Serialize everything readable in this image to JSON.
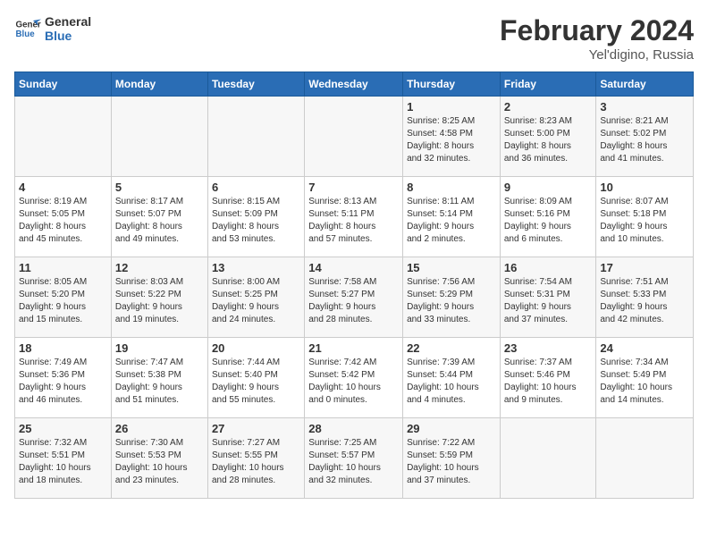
{
  "header": {
    "logo_line1": "General",
    "logo_line2": "Blue",
    "month_year": "February 2024",
    "location": "Yel'digino, Russia"
  },
  "weekdays": [
    "Sunday",
    "Monday",
    "Tuesday",
    "Wednesday",
    "Thursday",
    "Friday",
    "Saturday"
  ],
  "weeks": [
    [
      {
        "day": "",
        "info": ""
      },
      {
        "day": "",
        "info": ""
      },
      {
        "day": "",
        "info": ""
      },
      {
        "day": "",
        "info": ""
      },
      {
        "day": "1",
        "info": "Sunrise: 8:25 AM\nSunset: 4:58 PM\nDaylight: 8 hours\nand 32 minutes."
      },
      {
        "day": "2",
        "info": "Sunrise: 8:23 AM\nSunset: 5:00 PM\nDaylight: 8 hours\nand 36 minutes."
      },
      {
        "day": "3",
        "info": "Sunrise: 8:21 AM\nSunset: 5:02 PM\nDaylight: 8 hours\nand 41 minutes."
      }
    ],
    [
      {
        "day": "4",
        "info": "Sunrise: 8:19 AM\nSunset: 5:05 PM\nDaylight: 8 hours\nand 45 minutes."
      },
      {
        "day": "5",
        "info": "Sunrise: 8:17 AM\nSunset: 5:07 PM\nDaylight: 8 hours\nand 49 minutes."
      },
      {
        "day": "6",
        "info": "Sunrise: 8:15 AM\nSunset: 5:09 PM\nDaylight: 8 hours\nand 53 minutes."
      },
      {
        "day": "7",
        "info": "Sunrise: 8:13 AM\nSunset: 5:11 PM\nDaylight: 8 hours\nand 57 minutes."
      },
      {
        "day": "8",
        "info": "Sunrise: 8:11 AM\nSunset: 5:14 PM\nDaylight: 9 hours\nand 2 minutes."
      },
      {
        "day": "9",
        "info": "Sunrise: 8:09 AM\nSunset: 5:16 PM\nDaylight: 9 hours\nand 6 minutes."
      },
      {
        "day": "10",
        "info": "Sunrise: 8:07 AM\nSunset: 5:18 PM\nDaylight: 9 hours\nand 10 minutes."
      }
    ],
    [
      {
        "day": "11",
        "info": "Sunrise: 8:05 AM\nSunset: 5:20 PM\nDaylight: 9 hours\nand 15 minutes."
      },
      {
        "day": "12",
        "info": "Sunrise: 8:03 AM\nSunset: 5:22 PM\nDaylight: 9 hours\nand 19 minutes."
      },
      {
        "day": "13",
        "info": "Sunrise: 8:00 AM\nSunset: 5:25 PM\nDaylight: 9 hours\nand 24 minutes."
      },
      {
        "day": "14",
        "info": "Sunrise: 7:58 AM\nSunset: 5:27 PM\nDaylight: 9 hours\nand 28 minutes."
      },
      {
        "day": "15",
        "info": "Sunrise: 7:56 AM\nSunset: 5:29 PM\nDaylight: 9 hours\nand 33 minutes."
      },
      {
        "day": "16",
        "info": "Sunrise: 7:54 AM\nSunset: 5:31 PM\nDaylight: 9 hours\nand 37 minutes."
      },
      {
        "day": "17",
        "info": "Sunrise: 7:51 AM\nSunset: 5:33 PM\nDaylight: 9 hours\nand 42 minutes."
      }
    ],
    [
      {
        "day": "18",
        "info": "Sunrise: 7:49 AM\nSunset: 5:36 PM\nDaylight: 9 hours\nand 46 minutes."
      },
      {
        "day": "19",
        "info": "Sunrise: 7:47 AM\nSunset: 5:38 PM\nDaylight: 9 hours\nand 51 minutes."
      },
      {
        "day": "20",
        "info": "Sunrise: 7:44 AM\nSunset: 5:40 PM\nDaylight: 9 hours\nand 55 minutes."
      },
      {
        "day": "21",
        "info": "Sunrise: 7:42 AM\nSunset: 5:42 PM\nDaylight: 10 hours\nand 0 minutes."
      },
      {
        "day": "22",
        "info": "Sunrise: 7:39 AM\nSunset: 5:44 PM\nDaylight: 10 hours\nand 4 minutes."
      },
      {
        "day": "23",
        "info": "Sunrise: 7:37 AM\nSunset: 5:46 PM\nDaylight: 10 hours\nand 9 minutes."
      },
      {
        "day": "24",
        "info": "Sunrise: 7:34 AM\nSunset: 5:49 PM\nDaylight: 10 hours\nand 14 minutes."
      }
    ],
    [
      {
        "day": "25",
        "info": "Sunrise: 7:32 AM\nSunset: 5:51 PM\nDaylight: 10 hours\nand 18 minutes."
      },
      {
        "day": "26",
        "info": "Sunrise: 7:30 AM\nSunset: 5:53 PM\nDaylight: 10 hours\nand 23 minutes."
      },
      {
        "day": "27",
        "info": "Sunrise: 7:27 AM\nSunset: 5:55 PM\nDaylight: 10 hours\nand 28 minutes."
      },
      {
        "day": "28",
        "info": "Sunrise: 7:25 AM\nSunset: 5:57 PM\nDaylight: 10 hours\nand 32 minutes."
      },
      {
        "day": "29",
        "info": "Sunrise: 7:22 AM\nSunset: 5:59 PM\nDaylight: 10 hours\nand 37 minutes."
      },
      {
        "day": "",
        "info": ""
      },
      {
        "day": "",
        "info": ""
      }
    ]
  ]
}
